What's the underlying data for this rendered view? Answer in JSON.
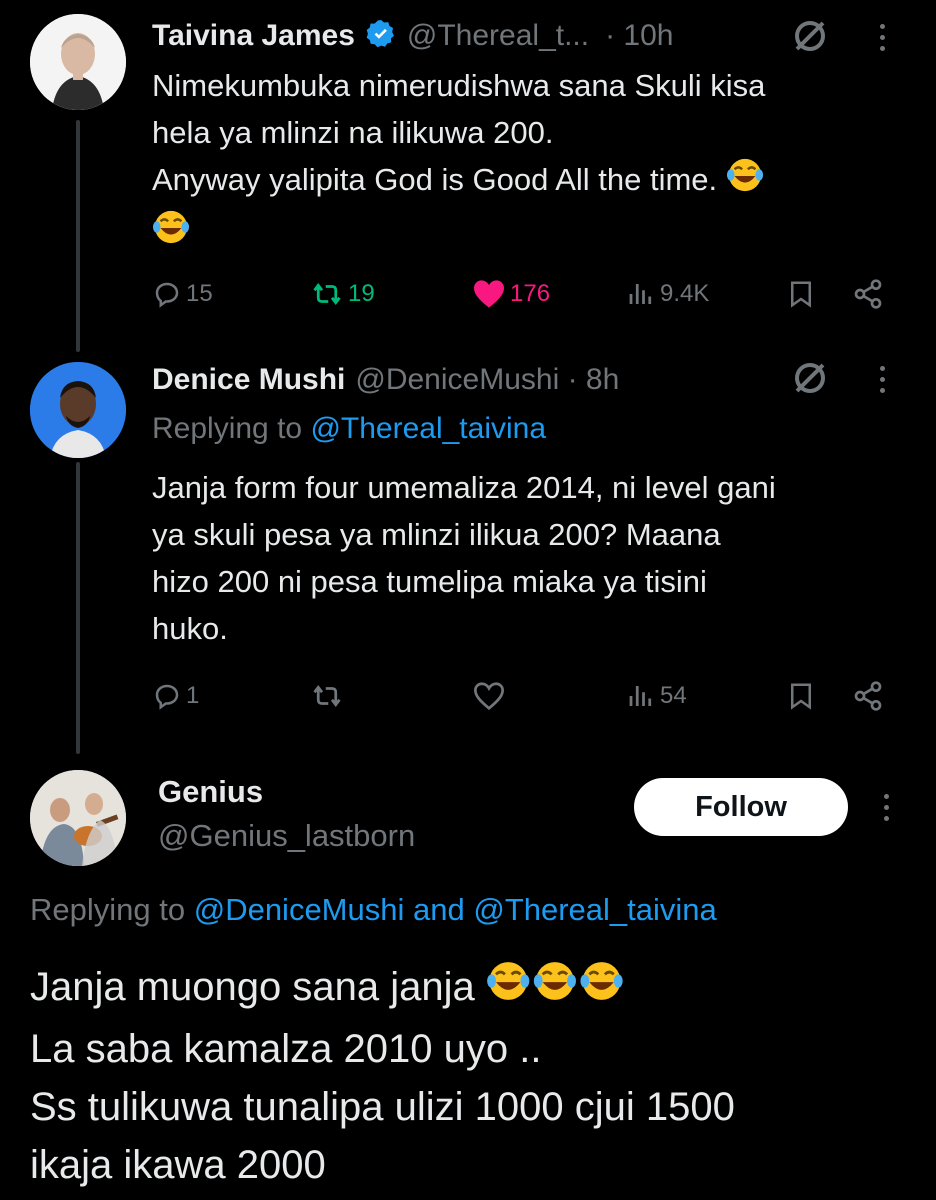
{
  "tweet1": {
    "name": "Taivina James",
    "handle": "@Thereal_t...",
    "time": "· 10h",
    "lines": [
      "Nimekumbuka nimerudishwa sana Skuli kisa",
      "hela ya mlinzi na ilikuwa 200.",
      "Anyway yalipita God is Good All the time."
    ],
    "replies": "15",
    "reposts": "19",
    "likes": "176",
    "views": "9.4K",
    "colors": {
      "repost": "#00ba7c",
      "like": "#f91880"
    }
  },
  "tweet2": {
    "name": "Denice Mushi",
    "handle": "@DeniceMushi · 8h",
    "replying_prefix": "Replying to ",
    "replying_handle": "@Thereal_taivina",
    "lines": [
      "Janja form four umemaliza 2014, ni level gani",
      "ya skuli pesa ya mlinzi ilikua 200? Maana",
      "hizo 200 ni pesa tumelipa miaka ya tisini",
      "huko."
    ],
    "replies": "1",
    "views": "54"
  },
  "tweet3": {
    "name": "Genius",
    "handle": "@Genius_lastborn",
    "follow_label": "Follow",
    "replying_prefix": "Replying to ",
    "replying_handle1": "@DeniceMushi",
    "replying_and": " and ",
    "replying_handle2": "@Thereal_taivina",
    "lines": [
      "Janja muongo sana janja",
      "La saba kamalza 2010 uyo ..",
      "Ss tulikuwa tunalipa ulizi 1000 cjui 1500",
      "ikaja ikawa 2000"
    ]
  },
  "icons": [
    "verified-badge-icon",
    "grok-icon",
    "more-icon",
    "reply-icon",
    "repost-icon",
    "like-icon",
    "views-icon",
    "bookmark-icon",
    "share-icon",
    "laughing-emoji"
  ],
  "colors": {
    "background": "#000000",
    "text": "#e7e9ea",
    "muted": "#71767b",
    "link": "#1d9bf0"
  }
}
